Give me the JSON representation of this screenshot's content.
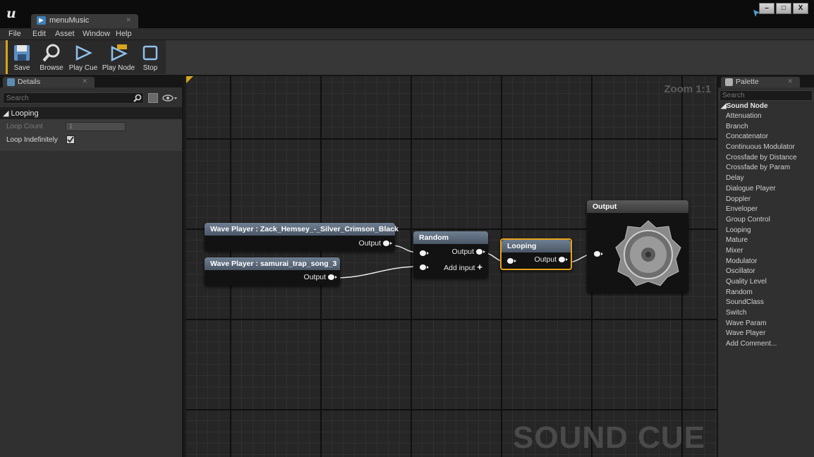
{
  "app": {
    "document_tab": "menuMusic",
    "window_buttons": [
      "–",
      "□",
      "X"
    ]
  },
  "menu": [
    "File",
    "Edit",
    "Asset",
    "Window",
    "Help"
  ],
  "toolbar": {
    "save": "Save",
    "browse": "Browse",
    "play_cue": "Play Cue",
    "play_node": "Play Node",
    "stop": "Stop"
  },
  "details": {
    "tab": "Details",
    "search_placeholder": "Search",
    "category": "Looping",
    "loop_count_label": "Loop Count",
    "loop_count_value": "1",
    "loop_indefinitely_label": "Loop Indefinitely",
    "loop_indefinitely_checked": true
  },
  "graph": {
    "zoom": "Zoom 1:1",
    "watermark": "SOUND CUE",
    "nodes": {
      "wave1": {
        "title": "Wave Player : Zack_Hemsey_-_Silver_Crimson_Black",
        "output": "Output"
      },
      "wave2": {
        "title": "Wave Player : samurai_trap_song_3",
        "output": "Output"
      },
      "random": {
        "title": "Random",
        "output": "Output",
        "add_input": "Add input"
      },
      "looping": {
        "title": "Looping",
        "output": "Output"
      },
      "output": {
        "title": "Output"
      }
    }
  },
  "palette": {
    "tab": "Palette",
    "search_placeholder": "Search",
    "category": "Sound Node",
    "items": [
      "Attenuation",
      "Branch",
      "Concatenator",
      "Continuous Modulator",
      "Crossfade by Distance",
      "Crossfade by Param",
      "Delay",
      "Dialogue Player",
      "Doppler",
      "Enveloper",
      "Group Control",
      "Looping",
      "Mature",
      "Mixer",
      "Modulator",
      "Oscillator",
      "Quality Level",
      "Random",
      "SoundClass",
      "Switch",
      "Wave Param",
      "Wave Player",
      "Add Comment..."
    ]
  },
  "colors": {
    "accent": "#d8a51b",
    "selection": "#e8a21a",
    "node_header": "#5a6878",
    "background": "#262626"
  }
}
